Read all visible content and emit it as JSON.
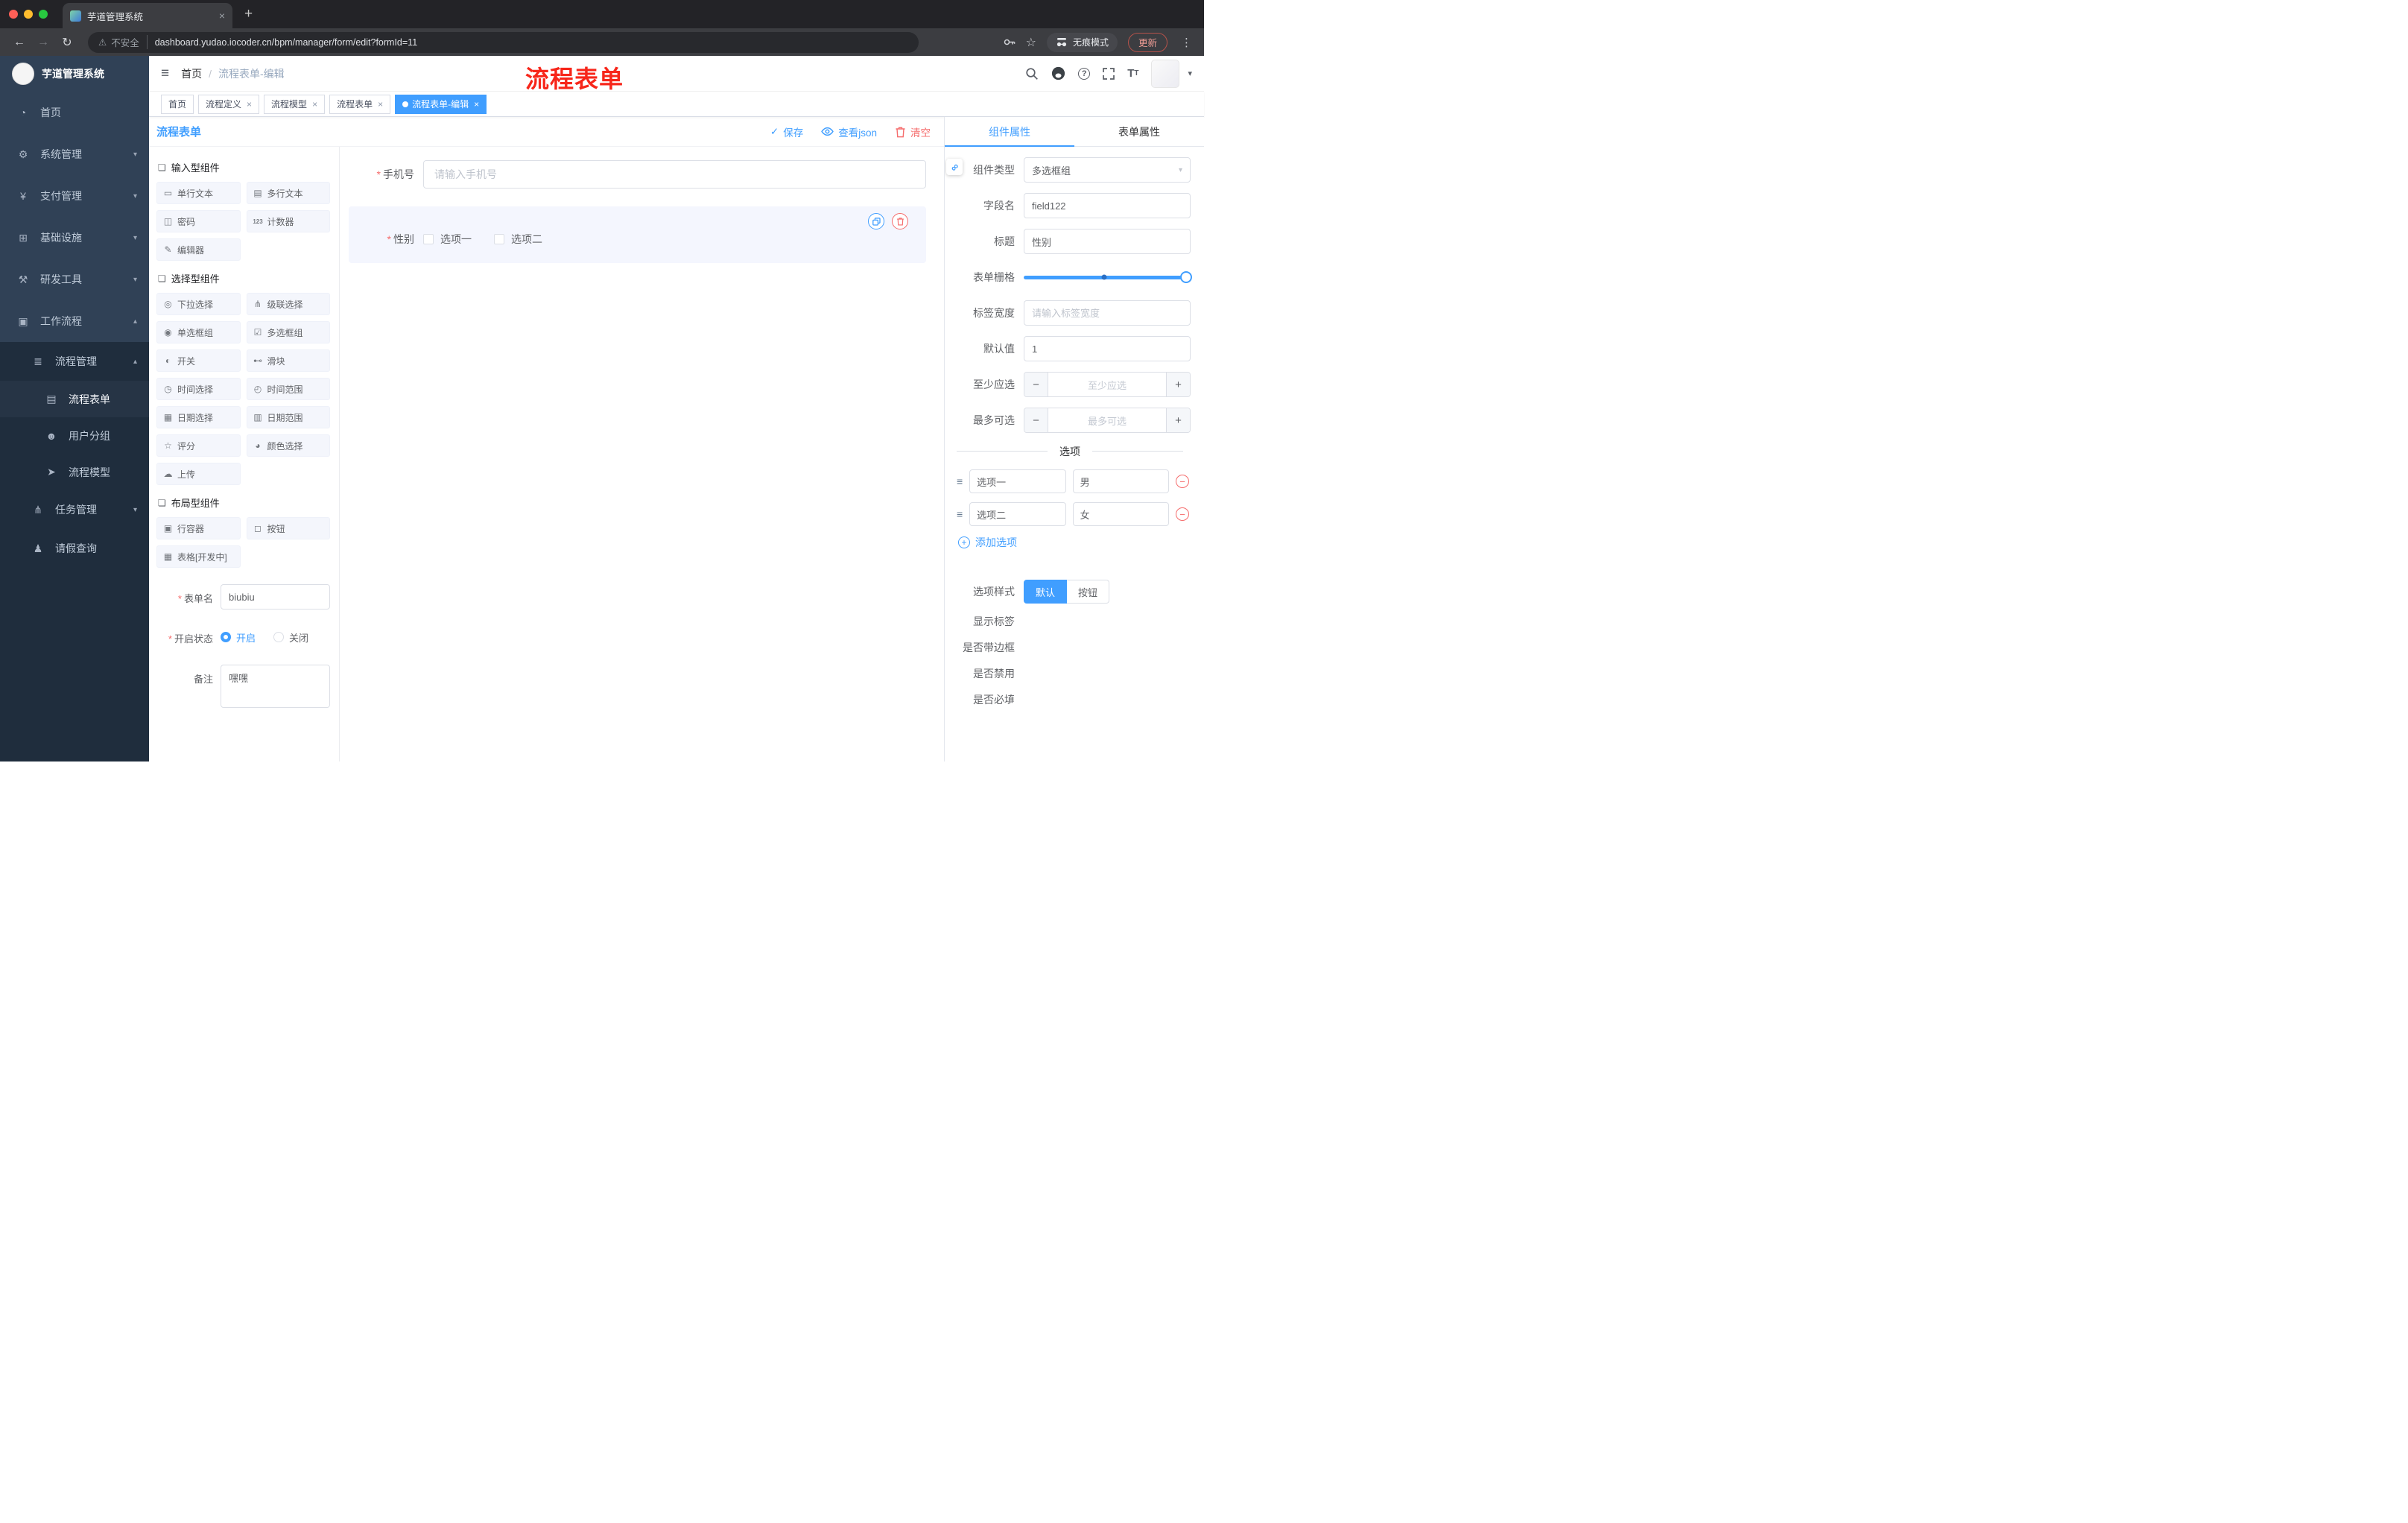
{
  "browser": {
    "tab_title": "芋道管理系统",
    "security_label": "不安全",
    "url": "dashboard.yudao.iocoder.cn/bpm/manager/form/edit?formId=11",
    "incognito_label": "无痕模式",
    "update_label": "更新"
  },
  "header": {
    "brand": "芋道管理系统",
    "breadcrumb_home": "首页",
    "breadcrumb_current": "流程表单-编辑",
    "annotation": "流程表单"
  },
  "tags": [
    {
      "label": "首页"
    },
    {
      "label": "流程定义"
    },
    {
      "label": "流程模型"
    },
    {
      "label": "流程表单"
    },
    {
      "label": "流程表单-编辑"
    }
  ],
  "sidebar": [
    {
      "label": "首页",
      "glyph": "◔"
    },
    {
      "label": "系统管理",
      "glyph": "⚙"
    },
    {
      "label": "支付管理",
      "glyph": "¥"
    },
    {
      "label": "基础设施",
      "glyph": "⊞"
    },
    {
      "label": "研发工具",
      "glyph": "⚒"
    },
    {
      "label": "工作流程",
      "glyph": "▣"
    },
    {
      "label": "流程管理",
      "glyph": "≣"
    },
    {
      "label": "流程表单",
      "glyph": "▤"
    },
    {
      "label": "用户分组",
      "glyph": "☻"
    },
    {
      "label": "流程模型",
      "glyph": "➤"
    },
    {
      "label": "任务管理",
      "glyph": "⋔"
    },
    {
      "label": "请假查询",
      "glyph": "♟"
    }
  ],
  "dtoolbar": {
    "title": "流程表单",
    "save": "保存",
    "view_json": "查看json",
    "clear": "清空"
  },
  "palette": {
    "sections": [
      {
        "title": "输入型组件"
      },
      {
        "title": "选择型组件"
      },
      {
        "title": "布局型组件"
      }
    ],
    "input_items": [
      {
        "label": "单行文本",
        "glyph": "▭"
      },
      {
        "label": "多行文本",
        "glyph": "▤"
      },
      {
        "label": "密码",
        "glyph": "◫"
      },
      {
        "label": "计数器",
        "glyph": "123"
      },
      {
        "label": "编辑器",
        "glyph": "✎"
      }
    ],
    "select_items": [
      {
        "label": "下拉选择",
        "glyph": "◎"
      },
      {
        "label": "级联选择",
        "glyph": "⋔"
      },
      {
        "label": "单选框组",
        "glyph": "◉"
      },
      {
        "label": "多选框组",
        "glyph": "☑"
      },
      {
        "label": "开关",
        "glyph": "◐"
      },
      {
        "label": "滑块",
        "glyph": "⊷"
      },
      {
        "label": "时间选择",
        "glyph": "◷"
      },
      {
        "label": "时间范围",
        "glyph": "◴"
      },
      {
        "label": "日期选择",
        "glyph": "▦"
      },
      {
        "label": "日期范围",
        "glyph": "▥"
      },
      {
        "label": "评分",
        "glyph": "☆"
      },
      {
        "label": "颜色选择",
        "glyph": "◕"
      },
      {
        "label": "上传",
        "glyph": "☁"
      }
    ],
    "layout_items": [
      {
        "label": "行容器",
        "glyph": "▣"
      },
      {
        "label": "按钮",
        "glyph": "◻"
      },
      {
        "label": "表格[开发中]",
        "glyph": "▦"
      }
    ]
  },
  "meta_form": {
    "name_label": "表单名",
    "name_value": "biubiu",
    "status_label": "开启状态",
    "status_on": "开启",
    "status_off": "关闭",
    "remark_label": "备注",
    "remark_value": "嘿嘿"
  },
  "canvas": {
    "phone_label": "手机号",
    "phone_placeholder": "请输入手机号",
    "gender_label": "性别",
    "gender_opt1": "选项一",
    "gender_opt2": "选项二"
  },
  "props": {
    "tab_component": "组件属性",
    "tab_form": "表单属性",
    "rows": {
      "type_label": "组件类型",
      "type_value": "多选框组",
      "field_label": "字段名",
      "field_value": "field122",
      "title_label": "标题",
      "title_value": "性别",
      "grid_label": "表单栅格",
      "width_label": "标签宽度",
      "width_placeholder": "请输入标签宽度",
      "default_label": "默认值",
      "default_value": "1",
      "min_label": "至少应选",
      "min_placeholder": "至少应选",
      "max_label": "最多可选",
      "max_placeholder": "最多可选"
    },
    "options_divider": "选项",
    "options": [
      {
        "name": "选项一",
        "value": "男"
      },
      {
        "name": "选项二",
        "value": "女"
      }
    ],
    "add_option": "添加选项",
    "style_label": "选项样式",
    "style_default": "默认",
    "style_button": "按钮",
    "switch_rows": [
      {
        "label": "显示标签",
        "on": true
      },
      {
        "label": "是否带边框",
        "on": false
      },
      {
        "label": "是否禁用",
        "on": false
      },
      {
        "label": "是否必填",
        "on": true
      }
    ]
  },
  "icons": {
    "hamburger": "≡",
    "chev_down": "▾",
    "chev_up": "▴",
    "close": "×",
    "plus": "+",
    "back": "←",
    "forward": "→",
    "reload": "↻",
    "warning": "⚠",
    "star": "☆",
    "dots": "⋮",
    "check": "✓",
    "slash": "/",
    "asterisk": "*",
    "sec": "❏",
    "minus": "−",
    "drag": "≡",
    "link": "∞",
    "caret": "▾",
    "question": "?",
    "text_big": "T",
    "text_small": "T"
  }
}
